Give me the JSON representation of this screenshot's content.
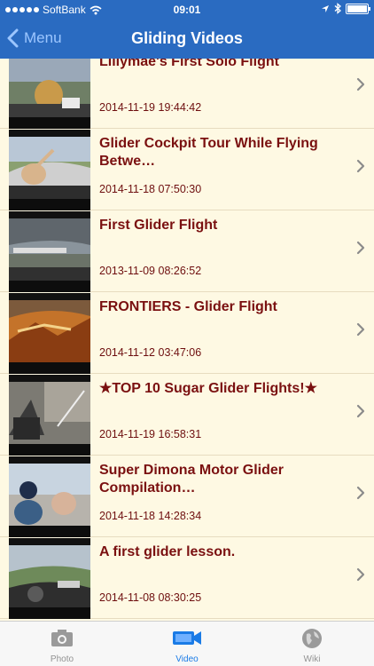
{
  "status_bar": {
    "carrier": "SoftBank",
    "time": "09:01"
  },
  "nav": {
    "back_label": "Menu",
    "title": "Gliding Videos"
  },
  "videos": [
    {
      "title": "Lillymae's First Solo Flight",
      "date": "2014-11-19 19:44:42"
    },
    {
      "title": "Glider Cockpit Tour While Flying Betwe…",
      "date": "2014-11-18 07:50:30"
    },
    {
      "title": "First Glider Flight",
      "date": "2013-11-09 08:26:52"
    },
    {
      "title": "FRONTIERS - Glider Flight",
      "date": "2014-11-12 03:47:06"
    },
    {
      "title": "★TOP 10 Sugar Glider Flights!★",
      "date": "2014-11-19 16:58:31"
    },
    {
      "title": "Super Dimona Motor Glider Compilation…",
      "date": "2014-11-18 14:28:34"
    },
    {
      "title": "A first glider lesson.",
      "date": "2014-11-08 08:30:25"
    }
  ],
  "tabs": [
    {
      "label": "Photo",
      "icon": "camera-icon"
    },
    {
      "label": "Video",
      "icon": "video-camera-icon",
      "active": true
    },
    {
      "label": "Wiki",
      "icon": "globe-icon"
    }
  ],
  "colors": {
    "nav": "#2a6bc1",
    "list_bg": "#fef9e3",
    "title_text": "#7a1010",
    "active_tab": "#1a7be6"
  }
}
